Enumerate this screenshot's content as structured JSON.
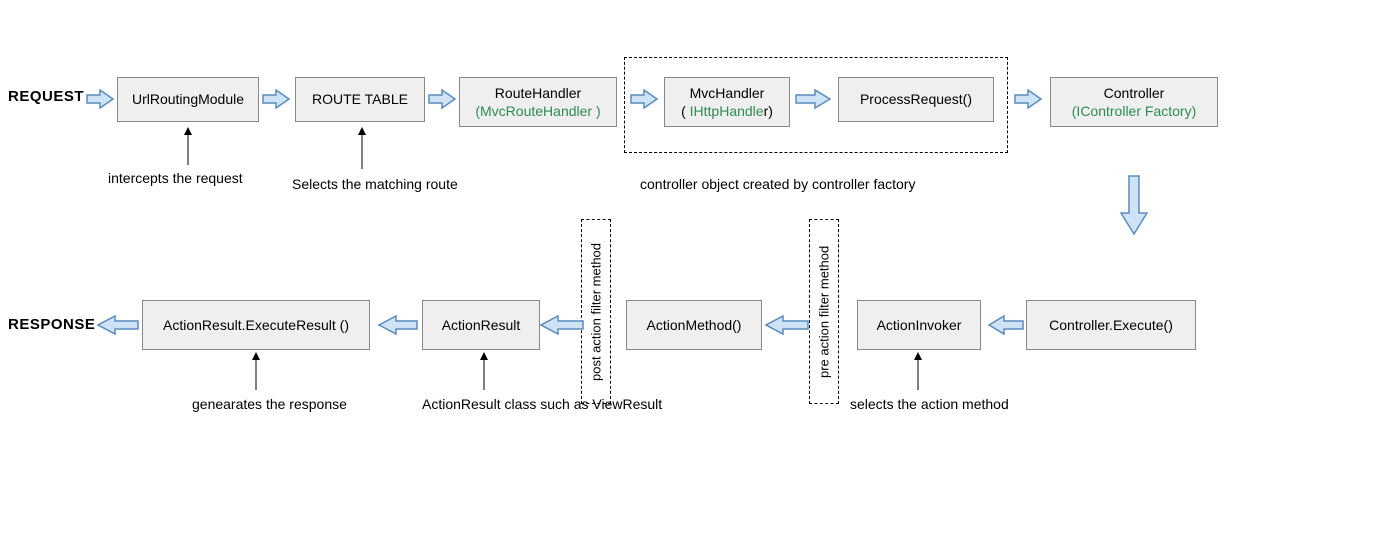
{
  "endpoints": {
    "request": "REQUEST",
    "response": "RESPONSE"
  },
  "row1": {
    "n1": {
      "line1": "UrlRoutingModule"
    },
    "n2": {
      "line1": "ROUTE  TABLE"
    },
    "n3": {
      "line1": "RouteHandler",
      "line2": "(MvcRouteHandler )"
    },
    "n4": {
      "line1": "MvcHandler",
      "line2": "( IHttpHandler)"
    },
    "n5": {
      "line1": "ProcessRequest()"
    },
    "n6": {
      "line1": "Controller",
      "line2": "(IController Factory)"
    }
  },
  "row2": {
    "n1": {
      "line1": "Controller.Execute()"
    },
    "n2": {
      "line1": "ActionInvoker"
    },
    "n3": {
      "line1": "ActionMethod()"
    },
    "n4": {
      "line1": "ActionResult"
    },
    "n5": {
      "line1": "ActionResult.ExecuteResult ()"
    }
  },
  "filters": {
    "pre": "pre  action filter method",
    "post": "post action filter method"
  },
  "annotations": {
    "intercepts": "intercepts the request",
    "selects_route": "Selects the matching  route",
    "controller_factory": "controller object created by controller factory",
    "selects_action": "selects the action method",
    "actionresult_class": "ActionResult class such as ViewResult",
    "generates_response": "genearates the response"
  }
}
